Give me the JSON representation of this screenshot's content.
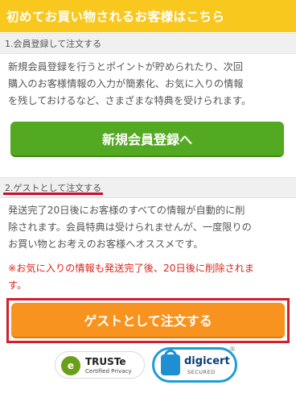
{
  "header": {
    "title": "初めてお買い物されるお客様はこちら"
  },
  "member_section": {
    "heading": "1.会員登録して注文する",
    "description_lines": [
      "新規会員登録を行うとポイントが貯められたり、次回",
      "購入のお客様情報の入力が簡素化、お気に入りの情報",
      "を残しておけるなど、さまざまな特典を受けられます。"
    ],
    "button_label": "新規会員登録へ",
    "button_color": "#54a922"
  },
  "guest_section": {
    "heading": "2.ゲストとして注文する",
    "description_lines": [
      "発送完了20日後にお客様のすべての情報が自動的に削",
      "除されます。会員特典は受けられませんが、一度限りの",
      "お買い物とお考えのお客様へオススメです。"
    ],
    "warning_lines": [
      "※お気に入りの情報も発送完了後、20日後に削除されま",
      "す。"
    ],
    "button_label": "ゲストとして注文する",
    "button_color": "#f7931e",
    "highlight_color": "#d11f2e"
  },
  "badges": {
    "truste": {
      "name": "TRUSTe",
      "sub": "Certified Privacy"
    },
    "digicert": {
      "name": "digicert",
      "sub": "SECURED",
      "mark": "®"
    }
  },
  "colors": {
    "header": "#f9c81e",
    "warning": "#d9261c"
  }
}
